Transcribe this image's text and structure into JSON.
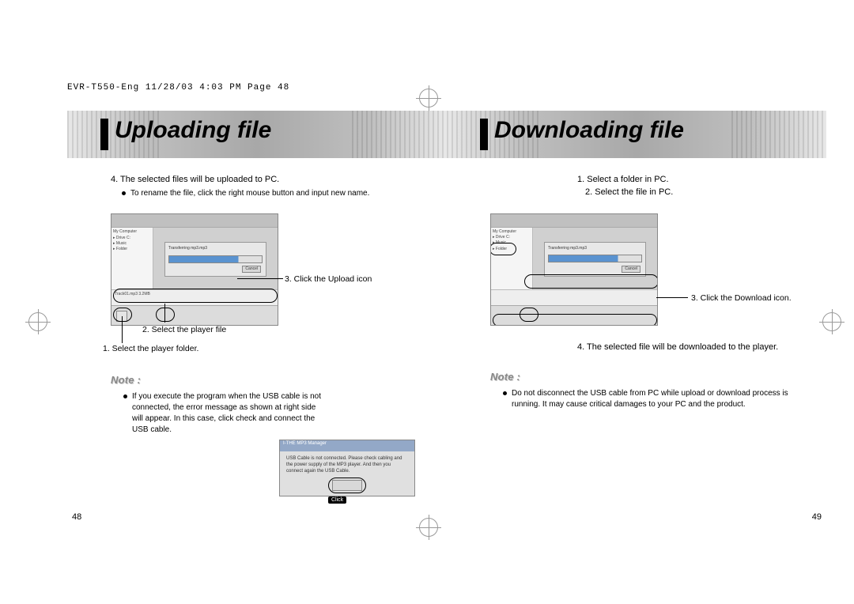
{
  "header_line": "EVR-T550-Eng  11/28/03  4:03 PM  Page 48",
  "left": {
    "title": "Uploading file",
    "step4": "4. The selected files will be uploaded to PC.",
    "rename_note": "To rename the file, click the right mouse button and input new name.",
    "callout_upload": "3. Click the Upload icon",
    "callout_playerfile": "2. Select the player file",
    "callout_playerfolder": "1. Select the player folder.",
    "note_label": "Note :",
    "note_text": "If you execute the program when the USB cable is not connected, the error message as shown at right side will appear. In this case, click check and connect the USB cable.",
    "error_title": "I-THE MP3 Manager",
    "error_msg": "USB Cable is not connected. Please check cabling and the power supply of the MP3 player. And then you connect again the USB Cable.",
    "click_label": "Click",
    "page_num": "48"
  },
  "right": {
    "title": "Downloading file",
    "step1": "1. Select a folder in PC.",
    "step2": "2. Select the file in PC.",
    "callout_download": "3. Click the Download icon.",
    "step4": "4. The selected file will be downloaded to the player.",
    "note_label": "Note :",
    "note_text": "Do not disconnect the USB cable from PC while upload or download process is running. It may cause critical damages to your PC and the product.",
    "page_num": "49"
  },
  "screenshot": {
    "progress_label": "Transferring mp3.mp3",
    "cancel_label": "Cancel"
  }
}
